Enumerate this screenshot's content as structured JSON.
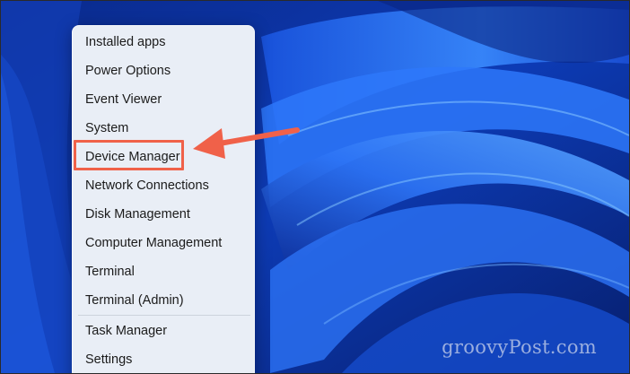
{
  "menu": {
    "items": [
      {
        "label": "Installed apps"
      },
      {
        "label": "Power Options"
      },
      {
        "label": "Event Viewer"
      },
      {
        "label": "System"
      },
      {
        "label": "Device Manager"
      },
      {
        "label": "Network Connections"
      },
      {
        "label": "Disk Management"
      },
      {
        "label": "Computer Management"
      },
      {
        "label": "Terminal"
      },
      {
        "label": "Terminal (Admin)"
      },
      {
        "label": "Task Manager"
      },
      {
        "label": "Settings"
      }
    ],
    "highlighted_item": "Device Manager"
  },
  "annotation": {
    "arrow_color": "#f06149",
    "box_color": "#f06149"
  },
  "watermark": {
    "text": "groovyPost.com"
  },
  "colors": {
    "wallpaper_dark": "#0a2a8c",
    "wallpaper_bright": "#2f7dff",
    "menu_background": "#e9eef6"
  }
}
